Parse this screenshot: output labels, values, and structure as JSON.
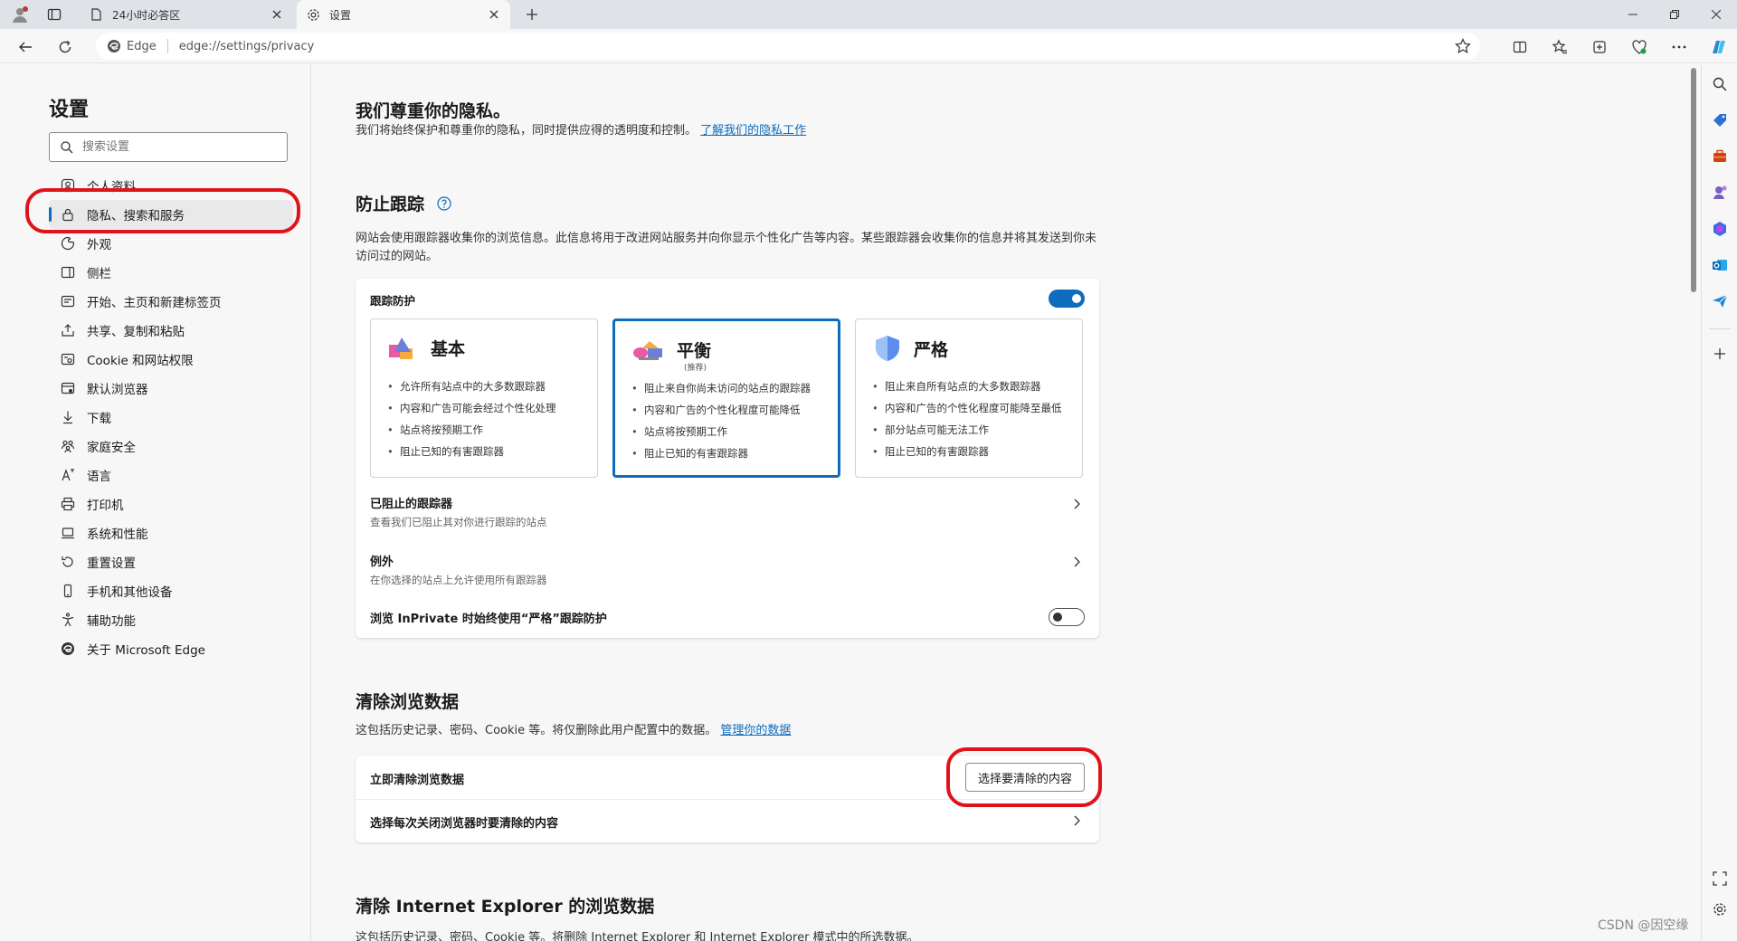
{
  "tabs": [
    {
      "title": "24小时必答区",
      "active": false
    },
    {
      "title": "设置",
      "active": true
    }
  ],
  "address_bar": {
    "brand": "Edge",
    "url": "edge://settings/privacy"
  },
  "nav": {
    "title": "设置",
    "search_placeholder": "搜索设置",
    "items": [
      {
        "label": "个人资料",
        "icon": "profile-icon",
        "active": false
      },
      {
        "label": "隐私、搜索和服务",
        "icon": "lock-icon",
        "active": true
      },
      {
        "label": "外观",
        "icon": "appearance-icon",
        "active": false
      },
      {
        "label": "侧栏",
        "icon": "sidebar-icon",
        "active": false
      },
      {
        "label": "开始、主页和新建标签页",
        "icon": "home-icon",
        "active": false
      },
      {
        "label": "共享、复制和粘贴",
        "icon": "share-icon",
        "active": false
      },
      {
        "label": "Cookie 和网站权限",
        "icon": "cookie-icon",
        "active": false
      },
      {
        "label": "默认浏览器",
        "icon": "browser-icon",
        "active": false
      },
      {
        "label": "下载",
        "icon": "download-icon",
        "active": false
      },
      {
        "label": "家庭安全",
        "icon": "family-icon",
        "active": false
      },
      {
        "label": "语言",
        "icon": "language-icon",
        "active": false
      },
      {
        "label": "打印机",
        "icon": "printer-icon",
        "active": false
      },
      {
        "label": "系统和性能",
        "icon": "system-icon",
        "active": false
      },
      {
        "label": "重置设置",
        "icon": "reset-icon",
        "active": false
      },
      {
        "label": "手机和其他设备",
        "icon": "phone-icon",
        "active": false
      },
      {
        "label": "辅助功能",
        "icon": "accessibility-icon",
        "active": false
      },
      {
        "label": "关于 Microsoft Edge",
        "icon": "edge-logo-icon",
        "active": false
      }
    ]
  },
  "privacy": {
    "title": "我们尊重你的隐私。",
    "desc": "我们将始终保护和尊重你的隐私，同时提供应得的透明度和控制。",
    "link": "了解我们的隐私工作"
  },
  "tracking": {
    "title": "防止跟踪",
    "desc": "网站会使用跟踪器收集你的浏览信息。此信息将用于改进网站服务并向你显示个性化广告等内容。某些跟踪器会收集你的信息并将其发送到你未访问过的网站。",
    "toggle_label": "跟踪防护",
    "toggle_on": true,
    "options": [
      {
        "name": "基本",
        "sub": "",
        "selected": false,
        "bullets": [
          "允许所有站点中的大多数跟踪器",
          "内容和广告可能会经过个性化处理",
          "站点将按预期工作",
          "阻止已知的有害跟踪器"
        ]
      },
      {
        "name": "平衡",
        "sub": "(推荐)",
        "selected": true,
        "bullets": [
          "阻止来自你尚未访问的站点的跟踪器",
          "内容和广告的个性化程度可能降低",
          "站点将按预期工作",
          "阻止已知的有害跟踪器"
        ]
      },
      {
        "name": "严格",
        "sub": "",
        "selected": false,
        "bullets": [
          "阻止来自所有站点的大多数跟踪器",
          "内容和广告的个性化程度可能降至最低",
          "部分站点可能无法工作",
          "阻止已知的有害跟踪器"
        ]
      }
    ],
    "blocked_title": "已阻止的跟踪器",
    "blocked_sub": "查看我们已阻止其对你进行跟踪的站点",
    "exceptions_title": "例外",
    "exceptions_sub": "在你选择的站点上允许使用所有跟踪器",
    "inprivate_label": "浏览 InPrivate 时始终使用“严格”跟踪防护",
    "inprivate_on": false
  },
  "clear": {
    "title": "清除浏览数据",
    "desc": "这包括历史记录、密码、Cookie 等。将仅删除此用户配置中的数据。",
    "link": "管理你的数据",
    "now_label": "立即清除浏览数据",
    "button_label": "选择要清除的内容",
    "on_close_label": "选择每次关闭浏览器时要清除的内容"
  },
  "ie": {
    "title": "清除 Internet Explorer 的浏览数据",
    "desc": "这包括历史记录、密码、Cookie 等。将删除 Internet Explorer 和 Internet Explorer 模式中的所选数据。"
  },
  "watermark": "CSDN @因空缘",
  "colors": {
    "accent": "#0f6cbd",
    "annotation_red": "#e0131a"
  }
}
